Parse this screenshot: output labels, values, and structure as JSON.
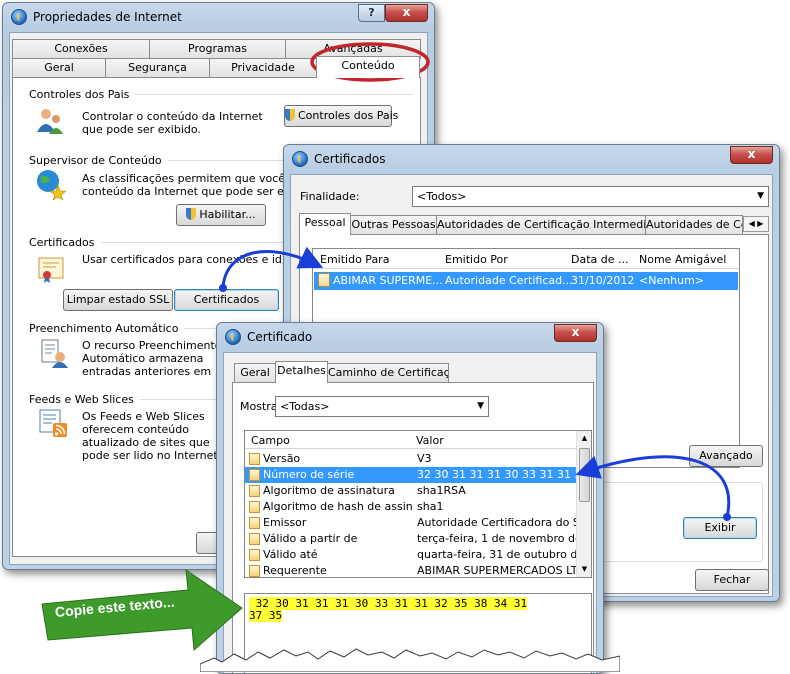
{
  "internet_options": {
    "title": "Propriedades de Internet",
    "help_label": "?",
    "close_label": "x",
    "tabs_row1": [
      "Conexões",
      "Programas",
      "Avançadas"
    ],
    "tabs_row2": [
      "Geral",
      "Segurança",
      "Privacidade",
      "Conteúdo"
    ],
    "parental": {
      "label": "Controles dos Pais",
      "text": "Controlar o conteúdo da Internet que pode ser exibido.",
      "button": "Controles dos Pais"
    },
    "supervisor": {
      "label": "Supervisor de Conteúdo",
      "text": "As classificações permitem que você controle o conteúdo da Internet que pode ser exibido no computador.",
      "button": "Habilitar..."
    },
    "certificates": {
      "label": "Certificados",
      "text": "Usar certificados para conexões e identificação.",
      "clear_ssl": "Limpar estado SSL",
      "button": "Certificados"
    },
    "autocomplete": {
      "label": "Preenchimento Automático",
      "text": "O recurso Preenchimento Automático armazena entradas anteriores em páginas da Web e sugere correspondências."
    },
    "feeds": {
      "label": "Feeds e Web Slices",
      "text": "Os Feeds e Web Slices oferecem conteúdo atualizado de sites que pode ser lido no Internet Explorer e em outros programas."
    }
  },
  "certificados": {
    "title": "Certificados",
    "close_label": "x",
    "purpose_label": "Finalidade:",
    "purpose_value": "<Todos>",
    "tabs": [
      "Pessoal",
      "Outras Pessoas",
      "Autoridades de Certificação Intermediárias",
      "Autoridades de Ce"
    ],
    "columns": [
      "Emitido Para",
      "Emitido Por",
      "Data de ...",
      "Nome Amigável"
    ],
    "rows": [
      {
        "issued_to": "ABIMAR SUPERME...",
        "issued_by": "Autoridade Certificad...",
        "date": "31/10/2012",
        "friendly": "<Nenhum>"
      }
    ],
    "advanced_button": "Avançado",
    "view_button": "Exibir",
    "close_button": "Fechar"
  },
  "certificado": {
    "title": "Certificado",
    "close_label": "x",
    "tabs": [
      "Geral",
      "Detalhes",
      "Caminho de Certificação"
    ],
    "show_label": "Mostrar:",
    "show_value": "<Todas>",
    "columns": [
      "Campo",
      "Valor"
    ],
    "rows": [
      {
        "field": "Versão",
        "value": "V3"
      },
      {
        "field": "Número de série",
        "value": "32 30 31 31 31 30 33 31 31 32..."
      },
      {
        "field": "Algoritmo de assinatura",
        "value": "sha1RSA"
      },
      {
        "field": "Algoritmo de hash de assina...",
        "value": "sha1"
      },
      {
        "field": "Emissor",
        "value": "Autoridade Certificadora do S..."
      },
      {
        "field": "Válido a partir de",
        "value": "terça-feira, 1 de novembro de..."
      },
      {
        "field": "Válido até",
        "value": "quarta-feira, 31 de outubro d..."
      },
      {
        "field": "Requerente",
        "value": "ABIMAR SUPERMERCADOS LT..."
      }
    ],
    "serial_line1": " 32 30 31 31 31 30 33 31 31 32 35 38 34 31",
    "serial_line2": "37 35"
  },
  "callout": {
    "text": "Copie este texto...",
    "color": "#3f9a2c"
  },
  "accent_colors": {
    "highlight_circle": "#c0262b",
    "arrow": "#1b3fd6",
    "selection": "#3399ff",
    "serial_highlight": "#ffff33"
  }
}
